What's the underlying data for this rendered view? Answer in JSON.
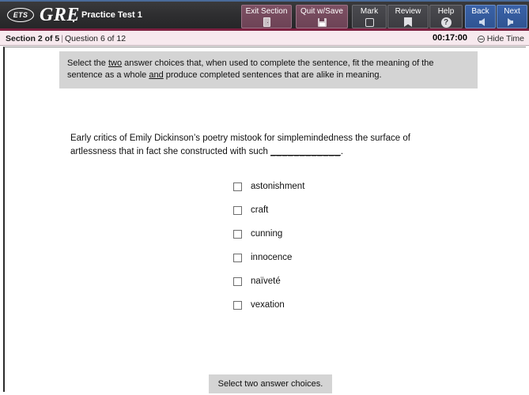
{
  "header": {
    "logo_text": "ETS",
    "brand": "GRE",
    "test_title": "Practice Test 1",
    "buttons": [
      {
        "label": "Exit Section",
        "icon": "door-icon",
        "style": "maroon"
      },
      {
        "label": "Quit w/Save",
        "icon": "floppy-disk-icon",
        "style": "maroon"
      },
      {
        "label": "Mark",
        "icon": "empty-square-icon",
        "style": "gray"
      },
      {
        "label": "Review",
        "icon": "bookmark-icon",
        "style": "gray"
      },
      {
        "label": "Help",
        "icon": "question-mark-circle-icon",
        "style": "gray"
      },
      {
        "label": "Back",
        "icon": "arrow-left-icon",
        "style": "blue"
      },
      {
        "label": "Next",
        "icon": "arrow-right-icon",
        "style": "blue"
      }
    ]
  },
  "status": {
    "section": "Section 2 of 5",
    "separator": "|",
    "question": "Question 6 of 12",
    "timer": "00:17:00",
    "hide_time_label": "Hide Time",
    "hide_time_icon": "minus-circle-icon"
  },
  "instructions": {
    "part1": "Select the ",
    "underline1": "two",
    "part2": " answer choices that, when used to complete the sentence, fit the meaning of the sentence as a whole ",
    "underline2": "and",
    "part3": " produce completed sentences that are alike in meaning."
  },
  "question": {
    "text_before_blank": "Early critics of Emily Dickinson’s poetry mistook for simplemindedness the surface of artlessness that in fact she constructed with such ",
    "blank": "____________",
    "text_after_blank": "."
  },
  "choices": [
    {
      "label": "astonishment",
      "checked": false
    },
    {
      "label": "craft",
      "checked": false
    },
    {
      "label": "cunning",
      "checked": false
    },
    {
      "label": "innocence",
      "checked": false
    },
    {
      "label": "naïveté",
      "checked": false
    },
    {
      "label": "vexation",
      "checked": false
    }
  ],
  "footer": {
    "hint": "Select two answer choices."
  },
  "colors": {
    "header_bg": "#2e2e30",
    "header_rule": "#7d2040",
    "topline": "#4a6b9a",
    "statusbar_bg": "#f7e9ee",
    "maroon_button": "#6d4356",
    "gray_button": "#3c3c41",
    "blue_button": "#2f5492",
    "panel_gray": "#d4d4d4"
  }
}
